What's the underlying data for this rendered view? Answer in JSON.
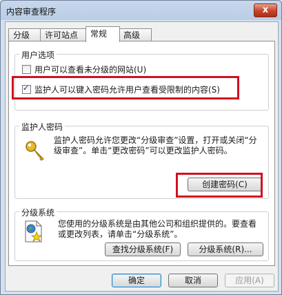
{
  "window": {
    "title": "内容审查程序",
    "close_glyph": "x"
  },
  "tabs": [
    {
      "label": "分级",
      "active": false
    },
    {
      "label": "许可站点",
      "active": false
    },
    {
      "label": "常规",
      "active": true
    },
    {
      "label": "高级",
      "active": false
    }
  ],
  "user_options": {
    "title": "用户选项",
    "option1": {
      "label": "用户可以查看未分级的网站(U)",
      "checked": false
    },
    "option2": {
      "label": "监护人可以键入密码允许用户查看受限制的内容(S)",
      "checked": true
    }
  },
  "supervisor": {
    "title": "监护人密码",
    "icon": "key-icon",
    "desc": "监护人密码允许您更改“分级审查”设置，打开或关闭“分级审查”。单击“更改密码”可以更改监护人密码。",
    "create_button": "创建密码(C)"
  },
  "rating_systems": {
    "title": "分级系统",
    "icon": "document-star-icon",
    "desc": "您使用的分级系统是由其他公司和组织提供的。要查看或更改列表，请单击“分级系统”。",
    "find_button": "查找分级系统(F)",
    "systems_button": "分级系统(R)..."
  },
  "footer": {
    "ok": "确定",
    "cancel": "取消",
    "apply": "应用(A)"
  },
  "colors": {
    "highlight": "#d01020",
    "title_bar": "#b9cde6"
  }
}
